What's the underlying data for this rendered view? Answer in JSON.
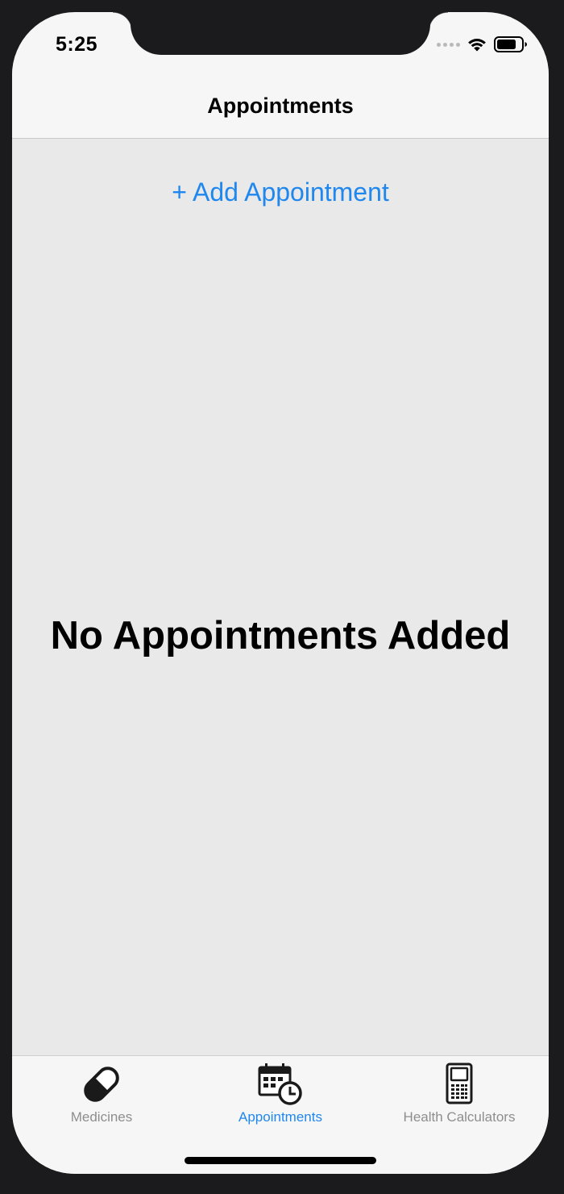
{
  "status_bar": {
    "time": "5:25",
    "wifi_icon": "wifi-icon",
    "battery_icon": "battery-icon",
    "signal_icon": "signal-dots-icon"
  },
  "nav": {
    "title": "Appointments"
  },
  "main": {
    "add_link": "+ Add Appointment",
    "empty_message": "No Appointments Added"
  },
  "tab_bar": {
    "tabs": [
      {
        "label": "Medicines",
        "icon": "pill-icon",
        "active": false
      },
      {
        "label": "Appointments",
        "icon": "calendar-clock-icon",
        "active": true
      },
      {
        "label": "Health Calculators",
        "icon": "calculator-icon",
        "active": false
      }
    ]
  },
  "colors": {
    "accent": "#1f87ee",
    "inactive_tab": "#8e8e8e",
    "content_bg": "#e9e9e9",
    "bar_bg": "#f6f6f6"
  }
}
